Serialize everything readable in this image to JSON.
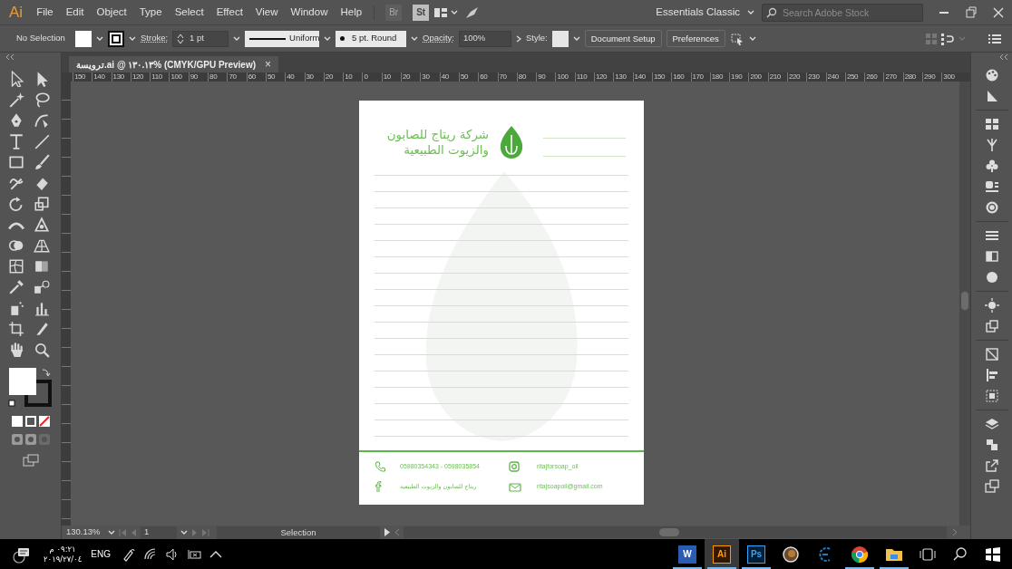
{
  "menu_bar": {
    "app_logo": "Ai",
    "menus": [
      "File",
      "Edit",
      "Object",
      "Type",
      "Select",
      "Effect",
      "View",
      "Window",
      "Help"
    ],
    "bridge_button": "Br",
    "stock_button": "St",
    "workspace": "Essentials Classic",
    "search": {
      "placeholder": "Search Adobe Stock"
    }
  },
  "control_bar": {
    "selection": "No Selection",
    "stroke_label": "Stroke:",
    "stroke_weight": "1 pt",
    "stroke_profile": "Uniform",
    "brush": "5 pt. Round",
    "opacity_label": "Opacity:",
    "opacity": "100%",
    "style_label": "Style:",
    "buttons": [
      "Document Setup",
      "Preferences"
    ]
  },
  "document_tab": {
    "title": "ترويسة.ai @ ١٣٠.١٣% (CMYK/GPU Preview)",
    "close": "×"
  },
  "ruler": {
    "labels": [
      "150",
      "140",
      "130",
      "120",
      "110",
      "100",
      "90",
      "80",
      "70",
      "60",
      "50",
      "40",
      "30",
      "20",
      "10",
      "0",
      "10",
      "20",
      "30",
      "40",
      "50",
      "60",
      "70",
      "80",
      "90",
      "100",
      "110",
      "120",
      "130",
      "140",
      "150",
      "160",
      "170",
      "180",
      "190",
      "200",
      "210",
      "220",
      "230",
      "240",
      "250",
      "260",
      "270",
      "280",
      "290",
      "300"
    ]
  },
  "artboard": {
    "company_name_lines": [
      "شركة ريتاج للصابون",
      "والزيوت الطبيعية"
    ],
    "contacts": [
      {
        "kind": "phone",
        "text": "05980354343 - 0598035854"
      },
      {
        "kind": "instagram",
        "text": "ritajforsoap_oil"
      },
      {
        "kind": "facebook",
        "text": "ريتاج للصابون والزيوت الطبيعية"
      },
      {
        "kind": "email",
        "text": "ritajsoapoil@gmail.com"
      }
    ]
  },
  "status_bar": {
    "zoom": "130.13%",
    "artboard_number": "1",
    "current_tool": "Selection"
  },
  "taskbar": {
    "time": "٠٩:٢١ م",
    "date": "٢٠١٩/٢٧/٠٤",
    "language": "ENG",
    "apps": [
      {
        "kind": "word",
        "label": "W",
        "running": true,
        "selected": false
      },
      {
        "kind": "illustrator",
        "label": "Ai",
        "running": true,
        "selected": true
      },
      {
        "kind": "photoshop",
        "label": "Ps",
        "running": true,
        "selected": false
      },
      {
        "kind": "globe",
        "running": false,
        "selected": false
      },
      {
        "kind": "c-app",
        "running": false,
        "selected": false
      },
      {
        "kind": "chrome",
        "running": true,
        "selected": false
      },
      {
        "kind": "folder",
        "running": true,
        "selected": false
      }
    ]
  }
}
